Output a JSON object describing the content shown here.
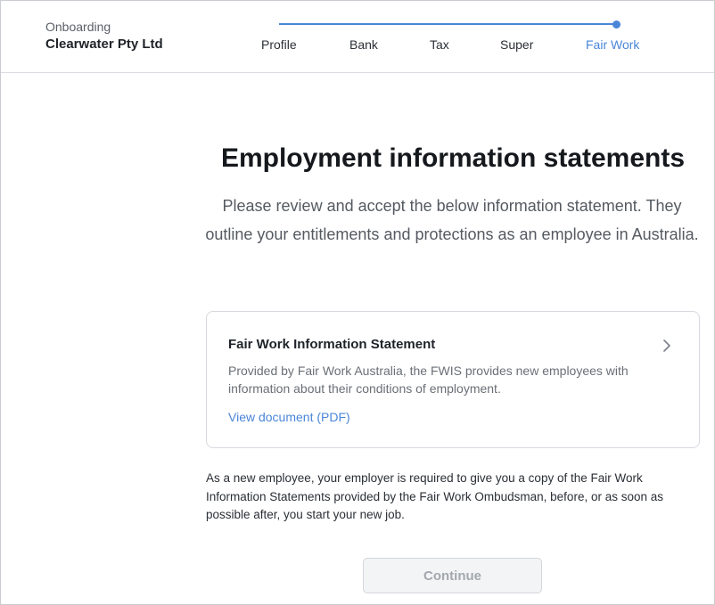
{
  "header": {
    "context_label": "Onboarding",
    "company_name": "Clearwater Pty Ltd",
    "steps": [
      {
        "label": "Profile",
        "state": "completed"
      },
      {
        "label": "Bank",
        "state": "completed"
      },
      {
        "label": "Tax",
        "state": "completed"
      },
      {
        "label": "Super",
        "state": "completed"
      },
      {
        "label": "Fair Work",
        "state": "current"
      }
    ],
    "progress_color": "#4a86d8"
  },
  "main": {
    "title": "Employment information statements",
    "intro": "Please review and accept the below information statement. They outline your entitlements and protections as an employee in Australia.",
    "card": {
      "title": "Fair Work Information Statement",
      "description": "Provided by Fair Work Australia, the FWIS provides new employees with information about their conditions of employment.",
      "link_label": "View document (PDF)",
      "chevron_icon": "chevron-right-icon"
    },
    "notice": "As a new employee, your employer is required to give you a copy of the Fair Work Information Statements provided by the Fair Work Ombudsman, before, or as soon as possible after, you start your new job.",
    "continue_label": "Continue",
    "continue_state": "disabled"
  }
}
